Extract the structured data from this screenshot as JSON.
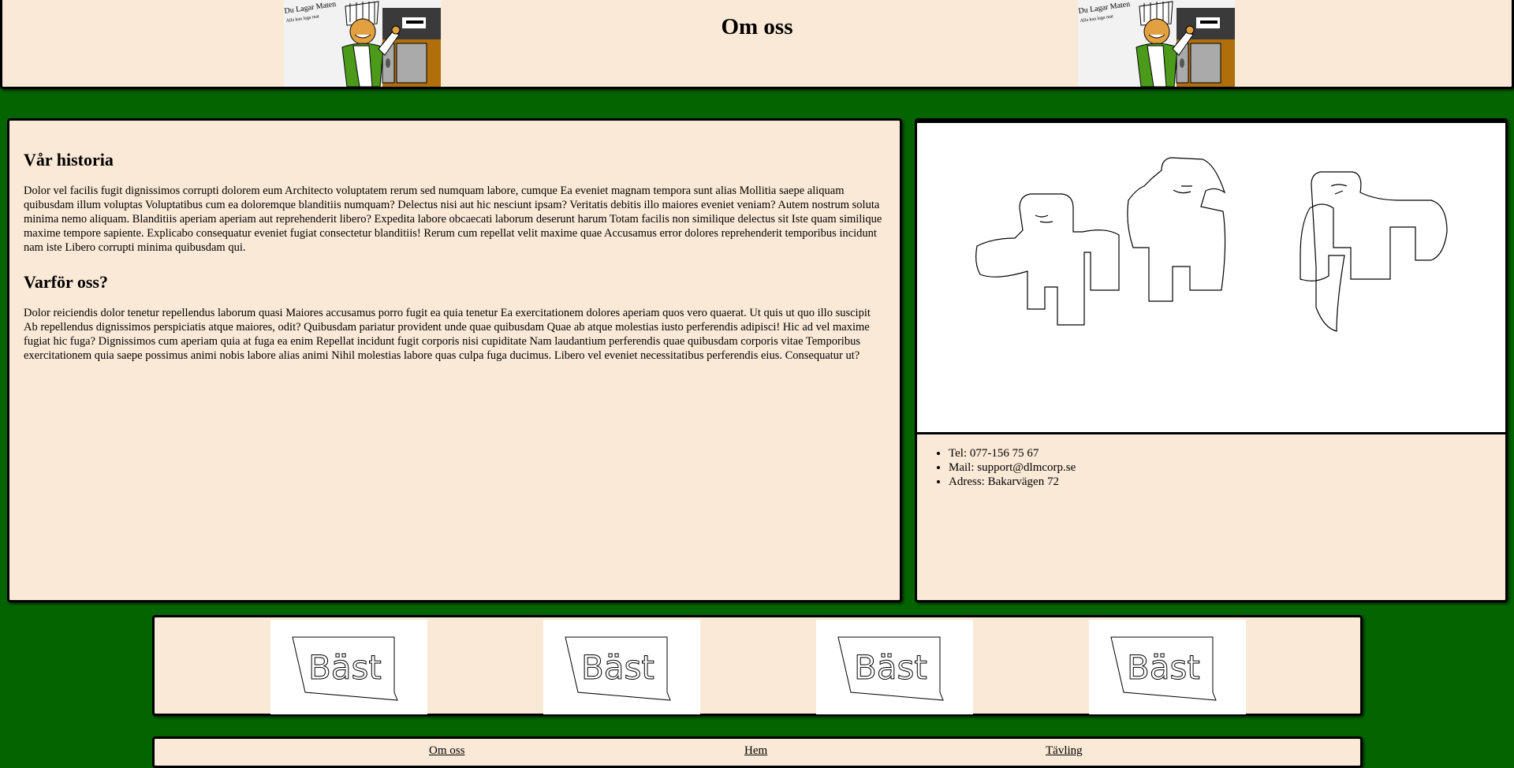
{
  "header": {
    "title": "Om oss",
    "logo": {
      "line1": "Du Lagar Maten",
      "line2": "Alla kan laga mat"
    }
  },
  "article": {
    "section1_title": "Vår historia",
    "section1_text": "Dolor vel facilis fugit dignissimos corrupti dolorem eum Architecto voluptatem rerum sed numquam labore, cumque Ea eveniet magnam tempora sunt alias Mollitia saepe aliquam quibusdam illum voluptas Voluptatibus cum ea doloremque blanditiis numquam? Delectus nisi aut hic nesciunt ipsam? Veritatis debitis illo maiores eveniet veniam? Autem nostrum soluta minima nemo aliquam. Blanditiis aperiam aperiam aut reprehenderit libero? Expedita labore obcaecati laborum deserunt harum Totam facilis non similique delectus sit Iste quam similique maxime tempore sapiente. Explicabo consequatur eveniet fugiat consectetur blanditiis! Rerum cum repellat velit maxime quae Accusamus error dolores reprehenderit temporibus incidunt nam iste Libero corrupti minima quibusdam qui.",
    "section2_title": "Varför oss?",
    "section2_text": "Dolor reiciendis dolor tenetur repellendus laborum quasi Maiores accusamus porro fugit ea quia tenetur Ea exercitationem dolores aperiam quos vero quaerat. Ut quis ut quo illo suscipit Ab repellendus dignissimos perspiciatis atque maiores, odit? Quibusdam pariatur provident unde quae quibusdam Quae ab atque molestias iusto perferendis adipisci! Hic ad vel maxime fugiat hic fuga? Dignissimos cum aperiam quia at fuga ea enim Repellat incidunt fugit corporis nisi cupiditate Nam laudantium perferendis quae quibusdam corporis vitae Temporibus exercitationem quia saepe possimus animi nobis labore alias animi Nihil molestias labore quas culpa fuga ducimus. Libero vel eveniet necessitatibus perferendis eius. Consequatur ut?"
  },
  "contact": {
    "items": [
      "Tel: 077-156 75 67",
      "Mail: support@dlmcorp.se",
      "Adress: Bakarvägen 72"
    ]
  },
  "banner": {
    "badge_text": "Bäst"
  },
  "nav": {
    "items": [
      "Om oss",
      "Hem",
      "Tävling"
    ]
  },
  "colors": {
    "background": "#036400",
    "panel": "#fae9d6",
    "chef_shirt": "#4c9a1a",
    "kitchen": "#b06f0a"
  }
}
